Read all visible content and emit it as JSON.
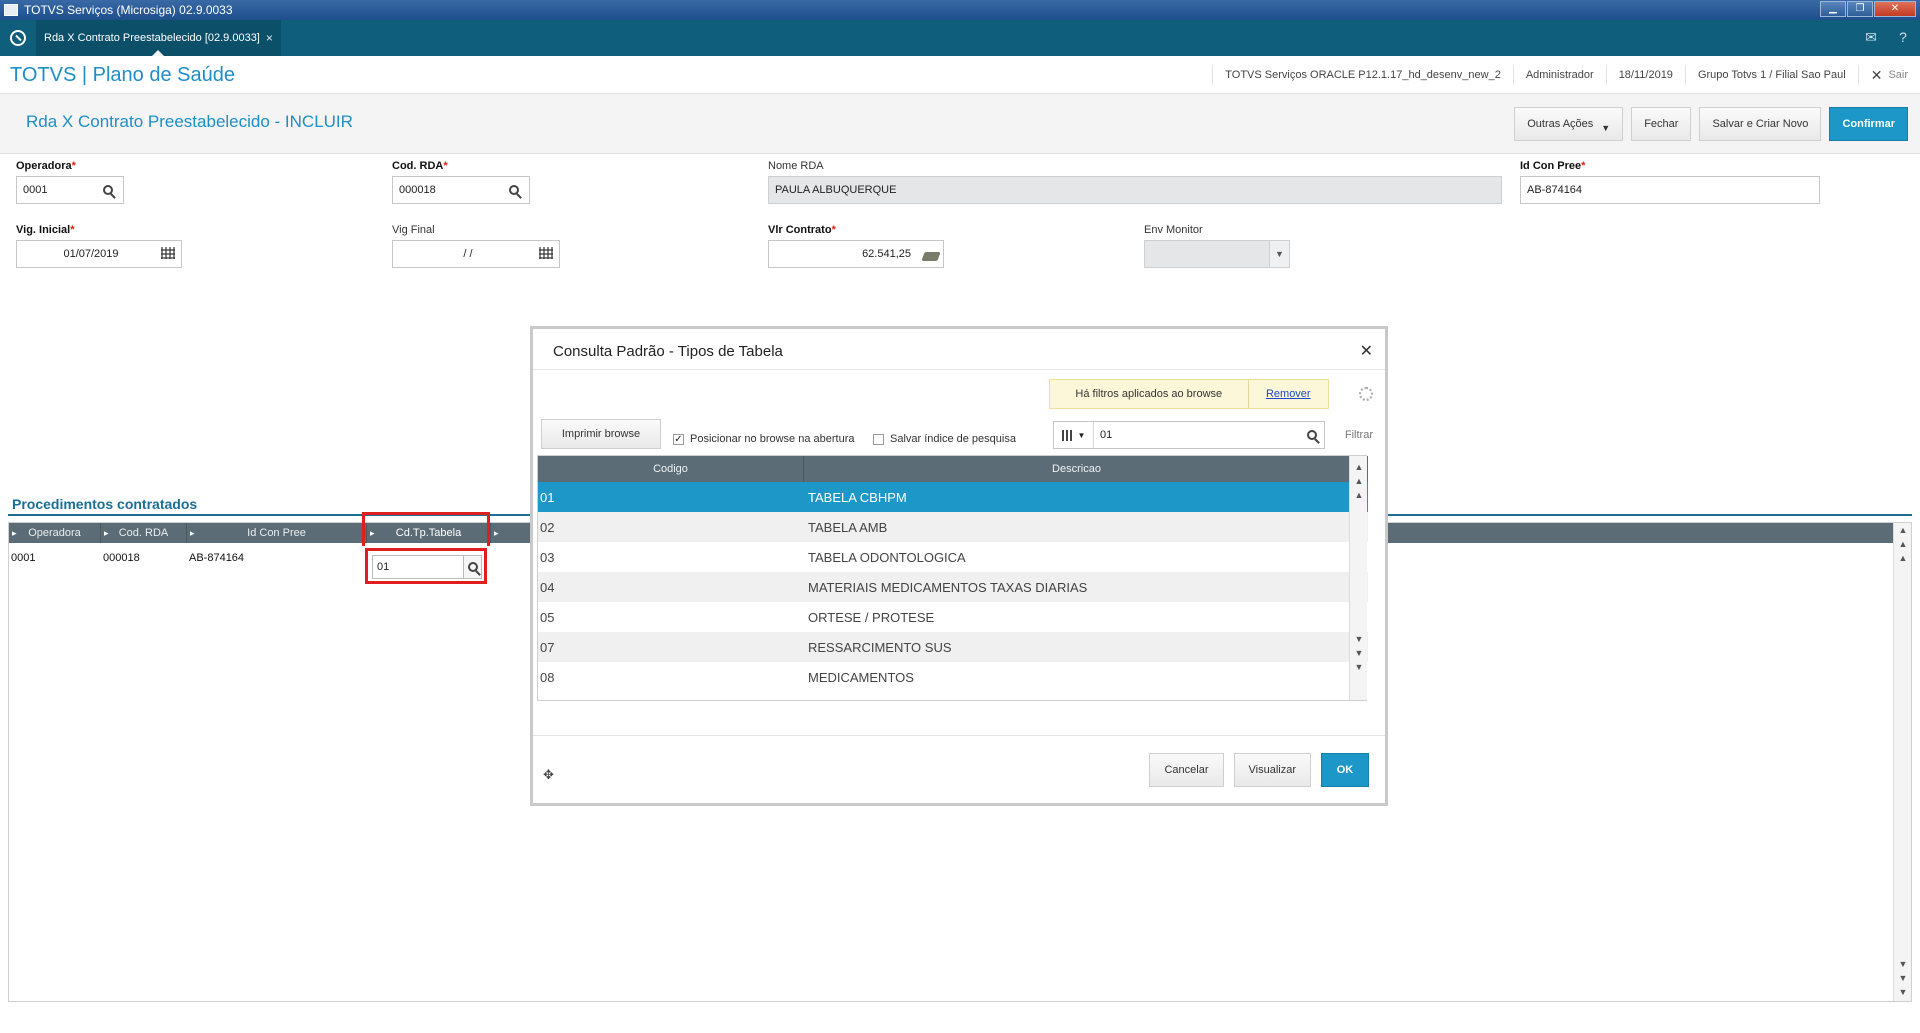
{
  "window": {
    "title": "TOTVS Serviços (Microsiga) 02.9.0033"
  },
  "tab": {
    "label": "Rda X Contrato Preestabelecido [02.9.0033]",
    "close": "×"
  },
  "header": {
    "brand": "TOTVS | Plano de Saúde",
    "environment": "TOTVS Serviços ORACLE P12.1.17_hd_desenv_new_2",
    "user": "Administrador",
    "date": "18/11/2019",
    "company": "Grupo Totvs 1 / Filial Sao Paul",
    "exit": "Sair"
  },
  "page": {
    "title": "Rda X Contrato Preestabelecido - INCLUIR",
    "actions": {
      "other": "Outras Ações",
      "close": "Fechar",
      "save_new": "Salvar e Criar Novo",
      "confirm": "Confirmar"
    }
  },
  "form": {
    "operadora": {
      "label": "Operadora",
      "value": "0001"
    },
    "cod_rda": {
      "label": "Cod. RDA",
      "value": "000018"
    },
    "nome_rda": {
      "label": "Nome RDA",
      "value": "PAULA ALBUQUERQUE"
    },
    "id_con_pree": {
      "label": "Id Con Pree",
      "value": "AB-874164"
    },
    "vig_inicial": {
      "label": "Vig. Inicial",
      "value": "01/07/2019"
    },
    "vig_final": {
      "label": "Vig Final",
      "value": "/ /"
    },
    "vlr_contrato": {
      "label": "Vlr Contrato",
      "value": "62.541,25"
    },
    "env_monitor": {
      "label": "Env Monitor",
      "value": ""
    }
  },
  "grid": {
    "title": "Procedimentos contratados",
    "columns": [
      "Operadora",
      "Cod. RDA",
      "Id Con Pree",
      "Cd.Tp.Tabela"
    ],
    "row": {
      "operadora": "0001",
      "cod_rda": "000018",
      "id_con_pree": "AB-874164",
      "cd_tp_tabela": "01"
    }
  },
  "modal": {
    "title": "Consulta Padrão - Tipos de Tabela",
    "filter_note": "Há filtros aplicados ao browse",
    "filter_remove": "Remover",
    "print_button": "Imprimir browse",
    "check_position": "Posicionar no browse na abertura",
    "check_save_index": "Salvar índice de pesquisa",
    "seek_value": "01",
    "filter_label": "Filtrar",
    "columns": [
      "Codigo",
      "Descricao"
    ],
    "rows": [
      {
        "code": "01",
        "desc": "TABELA CBHPM"
      },
      {
        "code": "02",
        "desc": "TABELA AMB"
      },
      {
        "code": "03",
        "desc": "TABELA ODONTOLOGICA"
      },
      {
        "code": "04",
        "desc": "MATERIAIS MEDICAMENTOS TAXAS DIARIAS"
      },
      {
        "code": "05",
        "desc": "ORTESE / PROTESE"
      },
      {
        "code": "07",
        "desc": "RESSARCIMENTO SUS"
      },
      {
        "code": "08",
        "desc": "MEDICAMENTOS"
      }
    ],
    "buttons": {
      "cancel": "Cancelar",
      "view": "Visualizar",
      "ok": "OK"
    }
  },
  "colors": {
    "accent": "#1d96c8",
    "tabbar": "#0e5e7c",
    "highlight": "#e01e1e"
  }
}
